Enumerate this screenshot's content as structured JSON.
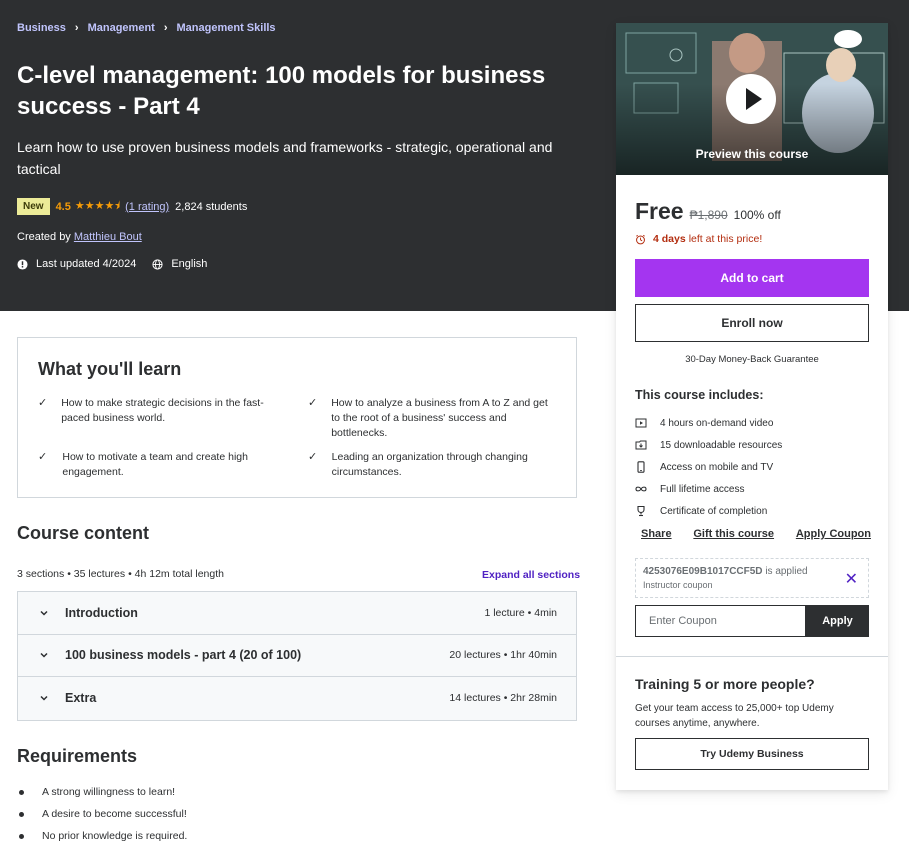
{
  "breadcrumb": [
    "Business",
    "Management",
    "Management Skills"
  ],
  "course": {
    "title": "C-level management: 100 models for business success - Part 4",
    "subtitle": "Learn how to use proven business models and frameworks - strategic, operational and tactical",
    "badge": "New",
    "rating": "4.5",
    "stars": "★★★★⯨",
    "rating_count": "(1 rating)",
    "students": "2,824 students",
    "created_by_label": "Created by",
    "instructor": "Matthieu Bout",
    "last_updated": "Last updated 4/2024",
    "language": "English"
  },
  "sidebar": {
    "preview_label": "Preview this course",
    "price": "Free",
    "original_price": "₱1,890",
    "discount": "100% off",
    "timer_bold": "4 days",
    "timer_rest": "left at this price!",
    "add_to_cart": "Add to cart",
    "enroll_now": "Enroll now",
    "guarantee": "30-Day Money-Back Guarantee",
    "includes_title": "This course includes:",
    "includes": [
      {
        "icon": "video-icon",
        "text": "4 hours on-demand video"
      },
      {
        "icon": "file-download-icon",
        "text": "15 downloadable resources"
      },
      {
        "icon": "mobile-icon",
        "text": "Access on mobile and TV"
      },
      {
        "icon": "infinity-icon",
        "text": "Full lifetime access"
      },
      {
        "icon": "trophy-icon",
        "text": "Certificate of completion"
      }
    ],
    "links": [
      "Share",
      "Gift this course",
      "Apply Coupon"
    ],
    "coupon_code": "4253076E09B1017CCF5D",
    "coupon_applied": "is applied",
    "coupon_type": "Instructor coupon",
    "coupon_placeholder": "Enter Coupon",
    "apply": "Apply",
    "training_title": "Training 5 or more people?",
    "training_desc": "Get your team access to 25,000+ top Udemy courses anytime, anywhere.",
    "try_business": "Try Udemy Business"
  },
  "learn": {
    "title": "What you'll learn",
    "items": [
      "How to make strategic decisions in the fast-paced business world.",
      "How to analyze a business from A to Z and get to the root of a business' success and bottlenecks.",
      "How to motivate a team and create high engagement.",
      "Leading an organization through changing circumstances."
    ]
  },
  "content": {
    "title": "Course content",
    "meta": "3 sections • 35 lectures • 4h 12m total length",
    "expand_all": "Expand all sections",
    "sections": [
      {
        "title": "Introduction",
        "info": "1 lecture • 4min"
      },
      {
        "title": "100 business models - part 4 (20 of 100)",
        "info": "20 lectures • 1hr 40min"
      },
      {
        "title": "Extra",
        "info": "14 lectures • 2hr 28min"
      }
    ]
  },
  "requirements": {
    "title": "Requirements",
    "items": [
      "A strong willingness to learn!",
      "A desire to become successful!",
      "No prior knowledge is required."
    ]
  },
  "colors": {
    "hero_bg": "#2d2f31",
    "accent_purple": "#a435f0",
    "link_purple": "#5022c3",
    "breadcrumb": "#c0c4fc",
    "star": "#f69c08",
    "timer": "#b32d0f",
    "badge_new": "#eceb98"
  }
}
